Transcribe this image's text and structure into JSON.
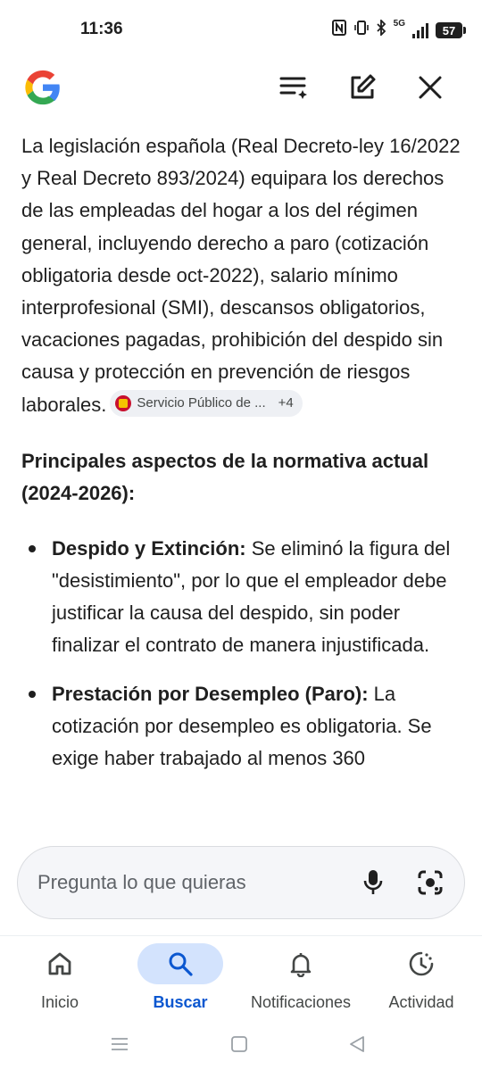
{
  "status_bar": {
    "time": "11:36",
    "network": "5G",
    "battery": "57"
  },
  "top_bar": {
    "logo": "google-g-logo",
    "actions": [
      "sort-sparkle-icon",
      "edit-icon",
      "close-icon"
    ]
  },
  "answer": {
    "paragraph": "La legislación española (Real Decreto-ley 16/2022 y Real Decreto 893/2024) equipara los derechos de las empleadas del hogar a los del régimen general, incluyendo derecho a paro (cotización obligatoria desde oct-2022), salario mínimo interprofesional (SMI), descansos obligatorios, vacaciones pagadas, prohibición del despido sin causa y protección en prevención de riesgos laborales.",
    "source_chip": {
      "label": "Servicio Público de ...",
      "more": "+4"
    },
    "heading": "Principales aspectos de la normativa actual (2024-2026):",
    "bullets": [
      {
        "title": "Despido y Extinción:",
        "text": " Se eliminó la figura del \"desistimiento\", por lo que el empleador debe justificar la causa del despido, sin poder finalizar el contrato de manera injustificada."
      },
      {
        "title": "Prestación por Desempleo (Paro):",
        "text": " La cotización por desempleo es obligatoria. Se exige haber trabajado al menos 360"
      }
    ]
  },
  "search": {
    "placeholder": "Pregunta lo que quieras"
  },
  "bottom_nav": {
    "items": [
      {
        "label": "Inicio",
        "icon": "home-icon",
        "active": false
      },
      {
        "label": "Buscar",
        "icon": "search-icon",
        "active": true
      },
      {
        "label": "Notificaciones",
        "icon": "bell-icon",
        "active": false
      },
      {
        "label": "Actividad",
        "icon": "activity-icon",
        "active": false
      }
    ]
  },
  "colors": {
    "accent": "#0b57d0",
    "active_pill": "#d3e3fd",
    "text": "#1f1f1f"
  }
}
